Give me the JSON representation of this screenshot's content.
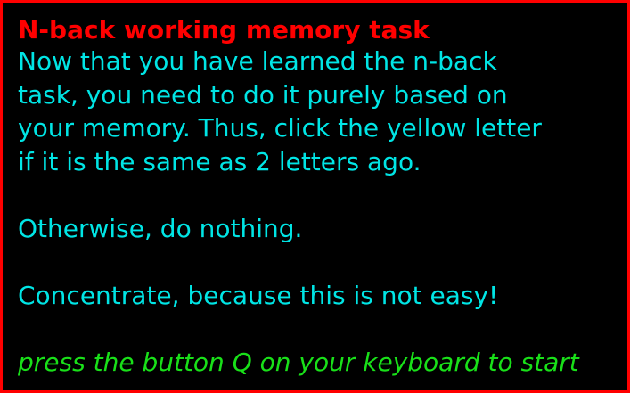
{
  "title": "N-back working memory task",
  "instructions": {
    "line1": "Now that you have learned the n-back",
    "line2": "task, you need to do it purely based on",
    "line3": "your memory. Thus, click the yellow letter",
    "line4": "if it is the same as 2 letters ago.",
    "line5": "Otherwise, do nothing.",
    "line6": "Concentrate, because this is not easy!"
  },
  "start_prompt": "press the button Q on your keyboard to start",
  "colors": {
    "border": "#ff0000",
    "background": "#000000",
    "title": "#ff0000",
    "instructions": "#00e5e5",
    "prompt": "#19e019"
  }
}
